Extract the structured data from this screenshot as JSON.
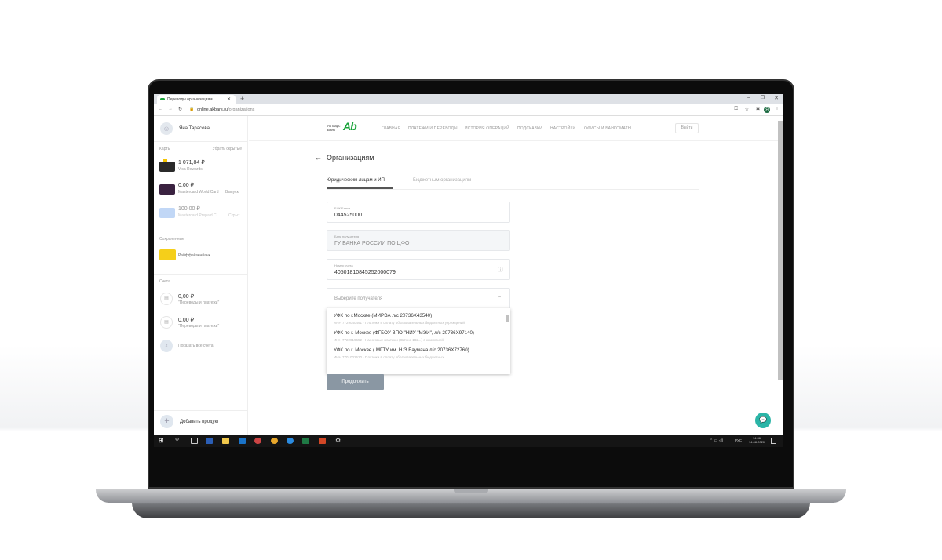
{
  "browser": {
    "tab_title": "Переводы организациям",
    "url_host": "online.akbars.ru",
    "url_path": "/organizations"
  },
  "sidebar": {
    "user_name": "Яна Тарасова",
    "cards_label": "Карты",
    "cards_action": "Убрать скрытые",
    "cards": [
      {
        "amount": "1 071,84 ₽",
        "name": "Visa Rewards",
        "number": "•• 5443",
        "status": "",
        "color": "#2a2a2a"
      },
      {
        "amount": "0,00 ₽",
        "name": "Mastercard World Card",
        "number": "•• 0939",
        "status": "Выпуск.",
        "color": "#3a2240"
      },
      {
        "amount": "100,00 ₽",
        "name": "Mastercard Prepaid C...",
        "number": "•• 1401",
        "status": "Скрыт",
        "color": "#8fb8f0"
      }
    ],
    "saved_label": "Сохраненные",
    "saved": [
      {
        "name": "Райффайзенбанк",
        "number": "•• 7766",
        "color": "#f5cf1a"
      }
    ],
    "accounts_label": "Счета",
    "accounts": [
      {
        "amount": "0,00 ₽",
        "name": "\"Переводы и платежи\""
      },
      {
        "amount": "0,00 ₽",
        "name": "\"Переводы и платежи\""
      }
    ],
    "show_all": "Показать все счета",
    "show_all_count": "2",
    "add_product": "Добавить продукт"
  },
  "header": {
    "logo_text1": "Ак Барс",
    "logo_text2": "Банк",
    "logo_mark": "Ab",
    "logo_color": "#19a33a",
    "nav": [
      "ГЛАВНАЯ",
      "ПЛАТЕЖИ И ПЕРЕВОДЫ",
      "ИСТОРИЯ ОПЕРАЦИЙ",
      "ПОДСКАЗКИ",
      "НАСТРОЙКИ",
      "ОФИСЫ И БАНКОМАТЫ"
    ],
    "logout": "Выйти"
  },
  "main": {
    "title": "Организациям",
    "tabs": [
      {
        "label": "Юридическим лицам и ИП",
        "active": true
      },
      {
        "label": "Бюджетным организациям",
        "active": false
      }
    ],
    "fields": [
      {
        "label": "БИК Банка",
        "value": "044525000"
      },
      {
        "label": "Банк получателя",
        "value": "ГУ БАНКА РОССИИ ПО ЦФО"
      },
      {
        "label": "Номер счета",
        "value": "40501810845252000079"
      }
    ],
    "recipient_placeholder": "Выберите получателя",
    "options": [
      {
        "title": "УФК по г.Москве (МИРЭА л/с 20736X43540)",
        "sub": "ИНН 7729040491 · Платежи в оплату образовательных бюджетных учреждений"
      },
      {
        "title": "УФК по г. Москве (ФГБОУ ВПО \"НИУ \"МЭИ\", л/с 20736X97140)",
        "sub": "ИНН 7722019652 · Налоговые платежи (КБК не 182...) с комиссией"
      },
      {
        "title": "УФК по г. Москве ( МГТУ им. Н.Э.Баумана л/с 20736X72760)",
        "sub": "ИНН 7701002520 · Платежи в оплату образовательных бюджетных"
      }
    ],
    "continue": "Продолжить",
    "accent": "#2bb5a7"
  },
  "taskbar": {
    "lang": "РУС",
    "time": "14:36",
    "date": "14.08.2020"
  }
}
